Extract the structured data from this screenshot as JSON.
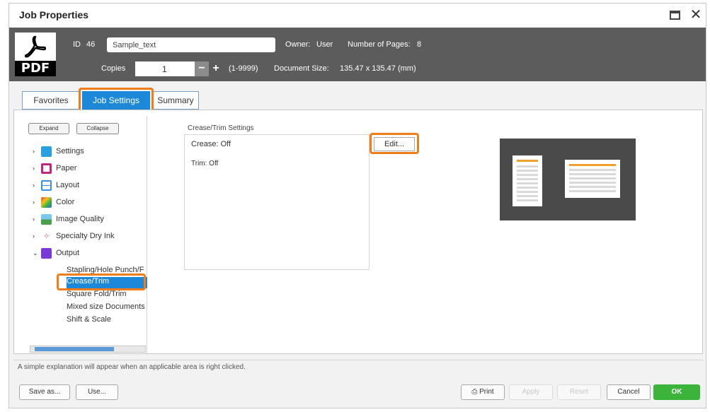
{
  "window": {
    "title": "Job Properties"
  },
  "header": {
    "file_icon_text": "PDF",
    "id_label": "ID",
    "id_value": "46",
    "name_value": "Sample_text",
    "owner_label": "Owner:",
    "owner_value": "User",
    "pages_label": "Number of Pages:",
    "pages_value": "8",
    "copies_label": "Copies",
    "copies_value": "1",
    "copies_range": "(1-9999)",
    "docsize_label": "Document Size:",
    "docsize_value": "135.47 x 135.47 (mm)"
  },
  "tabs": [
    {
      "label": "Favorites"
    },
    {
      "label": "Job Settings",
      "active": true
    },
    {
      "label": "Summary"
    }
  ],
  "tree": {
    "expand_label": "Expand",
    "collapse_label": "Collapse",
    "items": [
      {
        "label": "Settings",
        "icon": "settings-icon",
        "color": "#2a9fe0"
      },
      {
        "label": "Paper",
        "icon": "paper-icon",
        "color": "#c0287f"
      },
      {
        "label": "Layout",
        "icon": "layout-icon",
        "color": "#3a8fe0"
      },
      {
        "label": "Color",
        "icon": "color-icon",
        "color": "#e04a2a"
      },
      {
        "label": "Image Quality",
        "icon": "image-quality-icon",
        "color": "#3aa0d8"
      },
      {
        "label": "Specialty Dry Ink",
        "icon": "specialty-ink-icon",
        "color": "#e07aa0"
      },
      {
        "label": "Output",
        "icon": "output-icon",
        "color": "#7a3ad8"
      }
    ],
    "output_children": [
      {
        "label": "Stapling/Hole Punch/F"
      },
      {
        "label": "Crease/Trim",
        "selected": true
      },
      {
        "label": "Square Fold/Trim"
      },
      {
        "label": "Mixed size Documents"
      },
      {
        "label": "Shift & Scale"
      }
    ]
  },
  "crease_trim": {
    "group_title": "Crease/Trim Settings",
    "crease_label": "Crease: Off",
    "trim_label": "Trim: Off",
    "edit_label": "Edit..."
  },
  "status_text": "A simple explanation will appear when an applicable area is right clicked.",
  "footer": {
    "save_as": "Save as...",
    "use": "Use...",
    "print": "Print",
    "apply": "Apply",
    "reset": "Reset",
    "cancel": "Cancel",
    "ok": "OK"
  },
  "colors": {
    "highlight": "#f07d1a",
    "accent": "#1e88d8",
    "ok": "#3cb43c",
    "header_bg": "#5c5c5c"
  }
}
